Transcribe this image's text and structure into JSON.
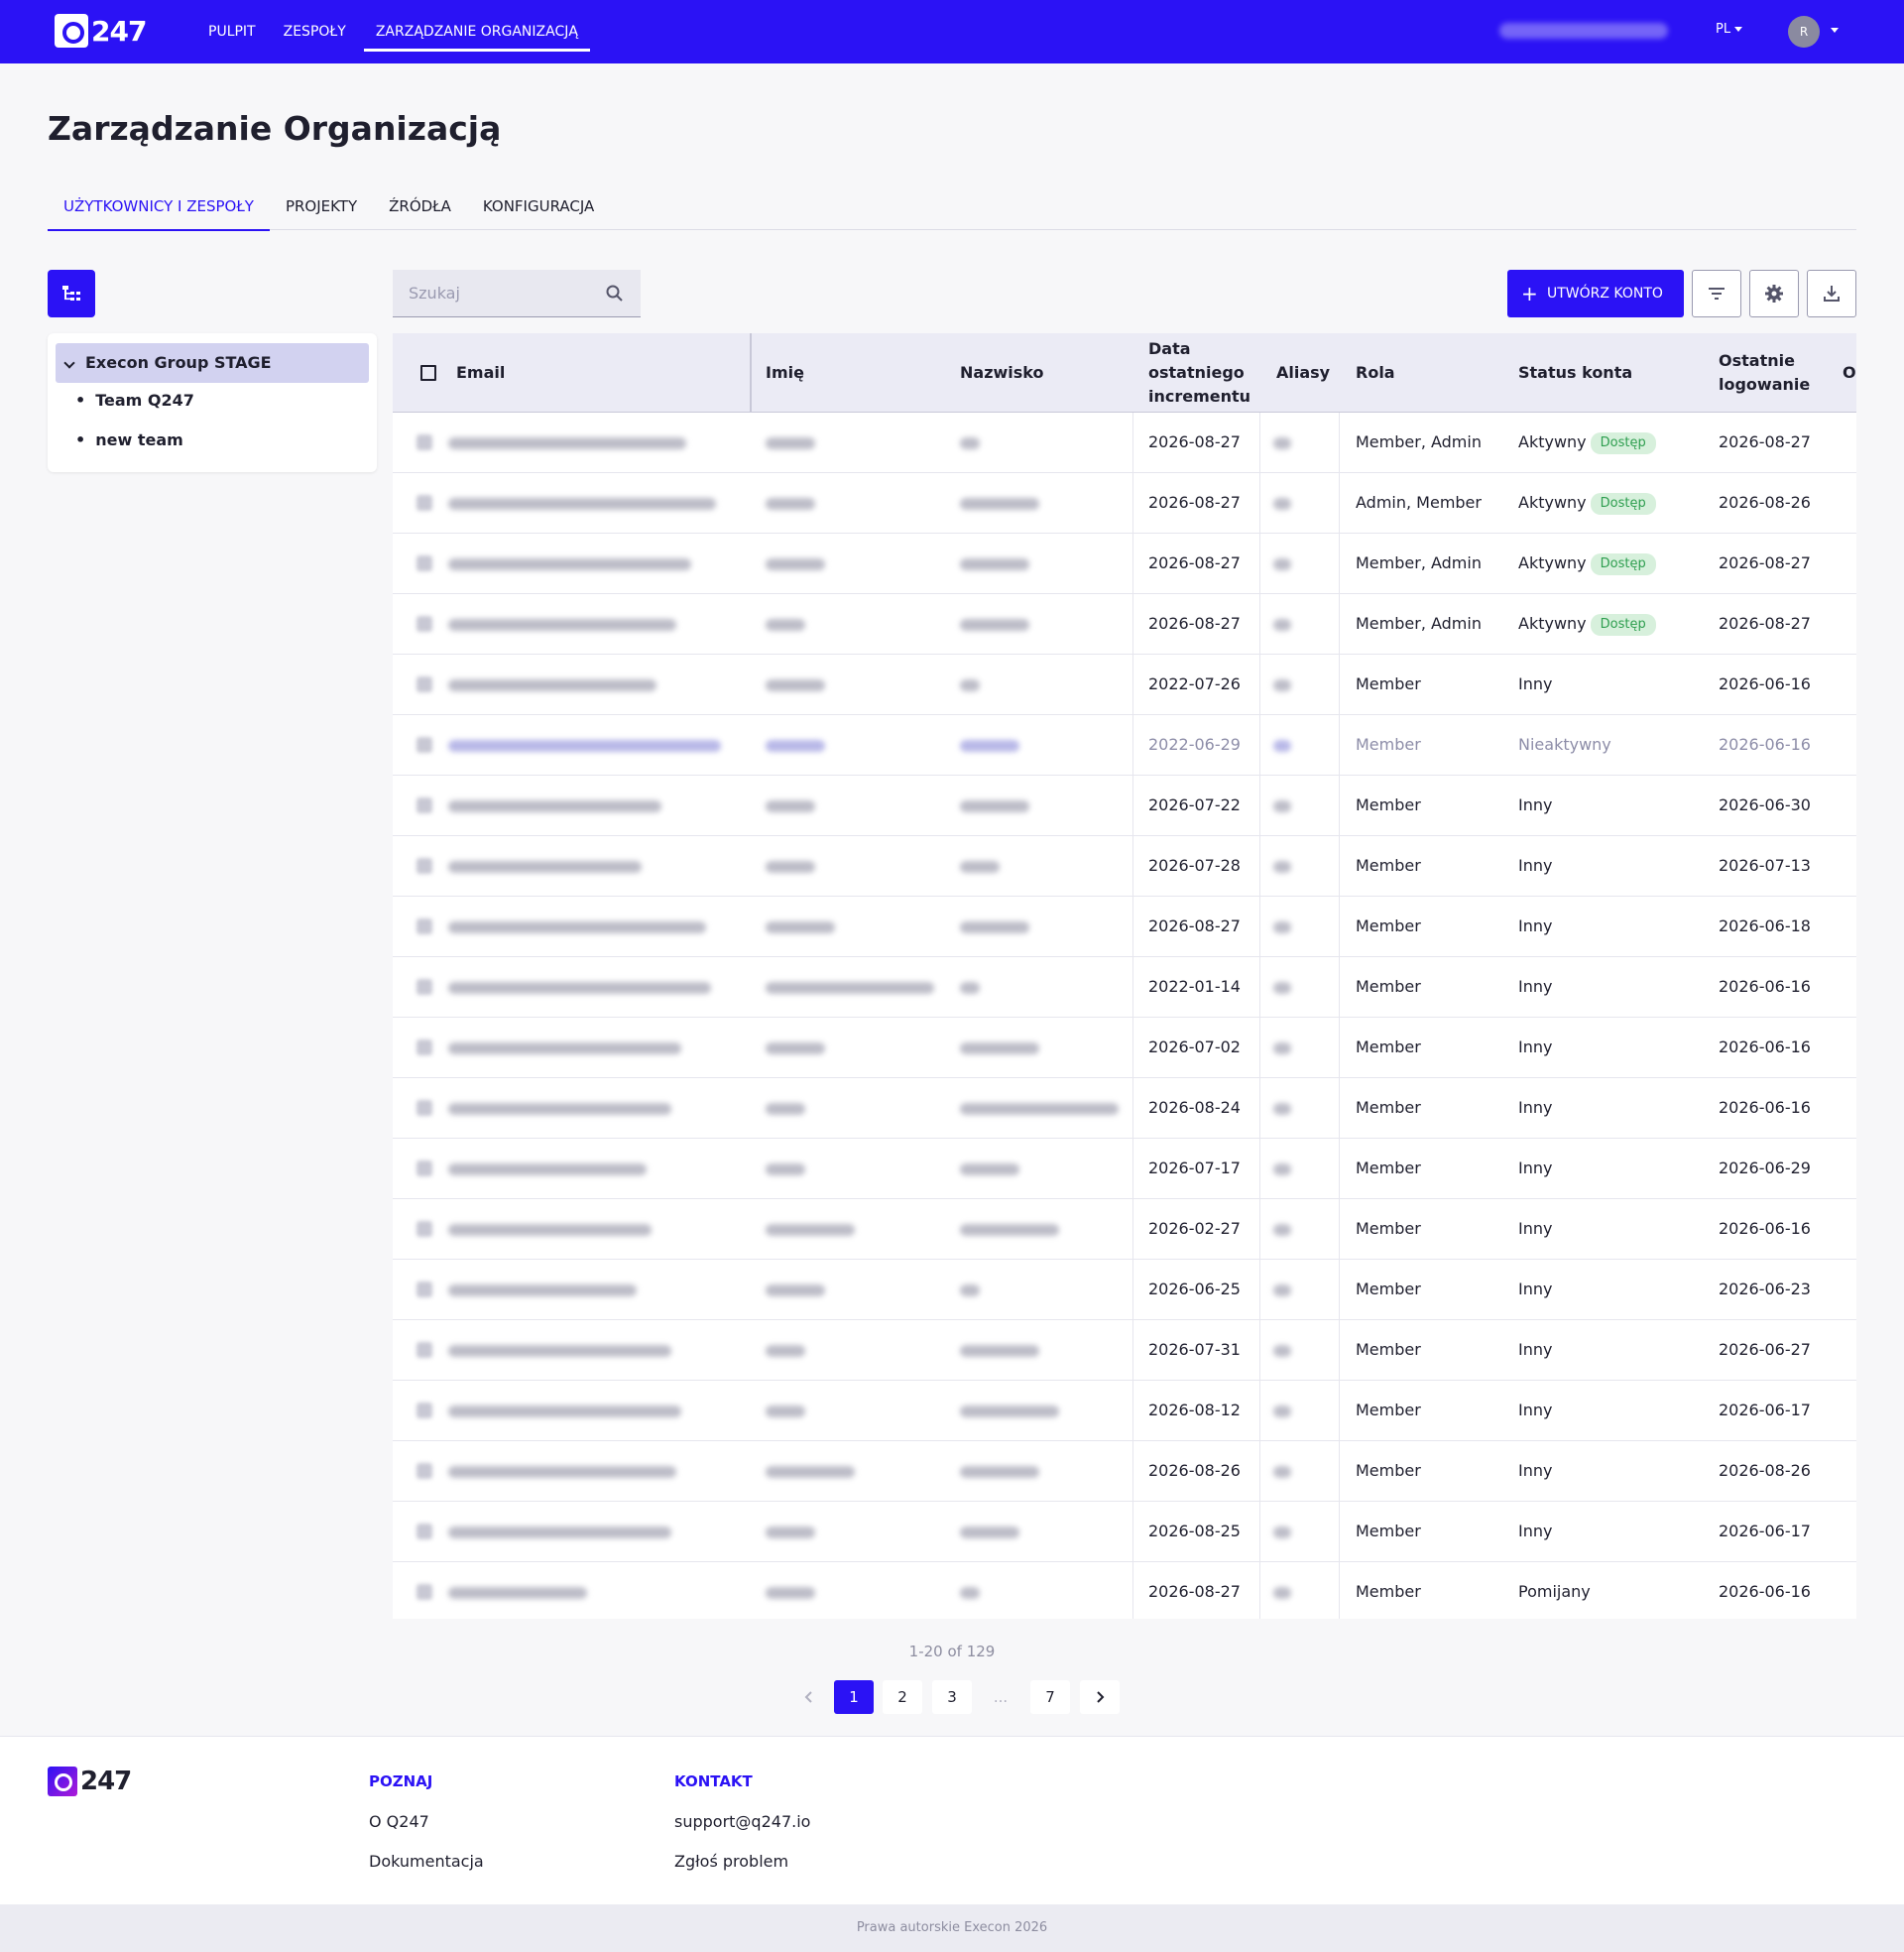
{
  "topbar": {
    "logo_text": "247",
    "nav": [
      "PULPIT",
      "ZESPOŁY",
      "ZARZĄDZANIE ORGANIZACJĄ"
    ],
    "lang": "PL",
    "avatar_initial": "R"
  },
  "page": {
    "title": "Zarządzanie Organizacją",
    "tabs": [
      "UŻYTKOWNICY I ZESPOŁY",
      "PROJEKTY",
      "ŹRÓDŁA",
      "KONFIGURACJA"
    ]
  },
  "tree": {
    "root": "Execon Group STAGE",
    "children": [
      "Team Q247",
      "new team"
    ]
  },
  "search": {
    "placeholder": "Szukaj"
  },
  "toolbar": {
    "create_label": "UTWÓRZ KONTO"
  },
  "table": {
    "headers": {
      "email": "Email",
      "imie": "Imię",
      "nazwisko": "Nazwisko",
      "data_line1": "Data",
      "data_line2": "ostatniego",
      "data_line3": "incrementu",
      "aliasy": "Aliasy",
      "rola": "Rola",
      "status": "Status konta",
      "ostatnie_line1": "Ostatnie",
      "ostatnie_line2": "logowanie",
      "overflow": "O"
    },
    "badge_label": "Dostęp",
    "rows": [
      {
        "date": "2026-08-27",
        "role": "Member, Admin",
        "status": "Aktywny",
        "badge": true,
        "last": "2026-08-27"
      },
      {
        "date": "2026-08-27",
        "role": "Admin, Member",
        "status": "Aktywny",
        "badge": true,
        "last": "2026-08-26"
      },
      {
        "date": "2026-08-27",
        "role": "Member, Admin",
        "status": "Aktywny",
        "badge": true,
        "last": "2026-08-27"
      },
      {
        "date": "2026-08-27",
        "role": "Member, Admin",
        "status": "Aktywny",
        "badge": true,
        "last": "2026-08-27"
      },
      {
        "date": "2022-07-26",
        "role": "Member",
        "status": "Inny",
        "badge": false,
        "last": "2026-06-16"
      },
      {
        "date": "2022-06-29",
        "role": "Member",
        "status": "Nieaktywny",
        "badge": false,
        "last": "2026-06-16",
        "inactive": true
      },
      {
        "date": "2026-07-22",
        "role": "Member",
        "status": "Inny",
        "badge": false,
        "last": "2026-06-30"
      },
      {
        "date": "2026-07-28",
        "role": "Member",
        "status": "Inny",
        "badge": false,
        "last": "2026-07-13"
      },
      {
        "date": "2026-08-27",
        "role": "Member",
        "status": "Inny",
        "badge": false,
        "last": "2026-06-18"
      },
      {
        "date": "2022-01-14",
        "role": "Member",
        "status": "Inny",
        "badge": false,
        "last": "2026-06-16"
      },
      {
        "date": "2026-07-02",
        "role": "Member",
        "status": "Inny",
        "badge": false,
        "last": "2026-06-16"
      },
      {
        "date": "2026-08-24",
        "role": "Member",
        "status": "Inny",
        "badge": false,
        "last": "2026-06-16"
      },
      {
        "date": "2026-07-17",
        "role": "Member",
        "status": "Inny",
        "badge": false,
        "last": "2026-06-29"
      },
      {
        "date": "2026-02-27",
        "role": "Member",
        "status": "Inny",
        "badge": false,
        "last": "2026-06-16"
      },
      {
        "date": "2026-06-25",
        "role": "Member",
        "status": "Inny",
        "badge": false,
        "last": "2026-06-23"
      },
      {
        "date": "2026-07-31",
        "role": "Member",
        "status": "Inny",
        "badge": false,
        "last": "2026-06-27"
      },
      {
        "date": "2026-08-12",
        "role": "Member",
        "status": "Inny",
        "badge": false,
        "last": "2026-06-17"
      },
      {
        "date": "2026-08-26",
        "role": "Member",
        "status": "Inny",
        "badge": false,
        "last": "2026-08-26"
      },
      {
        "date": "2026-08-25",
        "role": "Member",
        "status": "Inny",
        "badge": false,
        "last": "2026-06-17"
      },
      {
        "date": "2026-08-27",
        "role": "Member",
        "status": "Pomijany",
        "badge": false,
        "last": "2026-06-16"
      }
    ]
  },
  "pagination": {
    "summary": "1-20 of 129",
    "pages": [
      "1",
      "2",
      "3",
      "...",
      "7"
    ],
    "current": "1"
  },
  "footer": {
    "logo_text": "247",
    "col1_title": "POZNAJ",
    "col1_links": [
      "O Q247",
      "Dokumentacja"
    ],
    "col2_title": "KONTAKT",
    "col2_links": [
      "support@q247.io",
      "Zgłoś problem"
    ],
    "copyright": "Prawa autorskie Execon 2026"
  },
  "colors": {
    "brand": "#2b12f5",
    "badge_text": "#2e9e4f",
    "badge_bg": "#d7f0dc"
  }
}
